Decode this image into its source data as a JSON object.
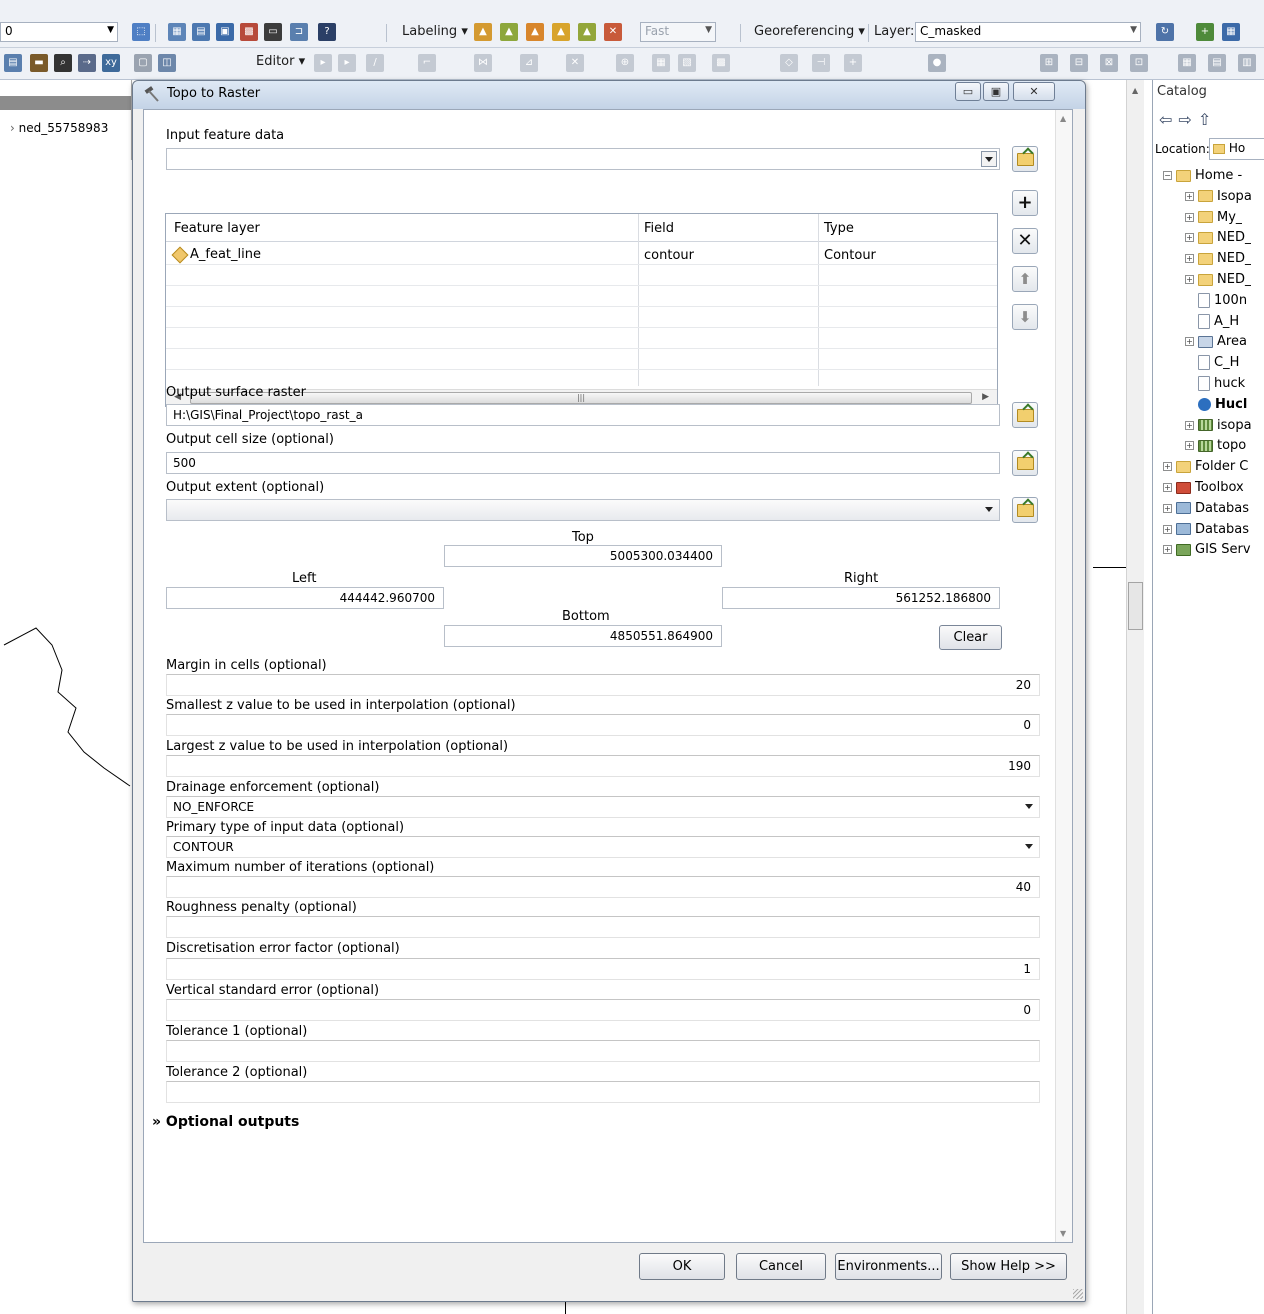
{
  "toolbar": {
    "scale_value": "0",
    "labeling_label": "Labeling",
    "quality_value": "Fast",
    "georeferencing_label": "Georeferencing",
    "layer_label": "Layer:",
    "layer_value": "C_masked",
    "editor_label": "Editor"
  },
  "toc": {
    "layer_name": "ned_55758983"
  },
  "catalog": {
    "title": "Catalog",
    "location_label": "Location:",
    "location_value": "Ho",
    "tree": [
      {
        "label": "Home -",
        "icon": "folder-icon",
        "expand": "minus"
      },
      {
        "label": "Isopa",
        "icon": "folder-icon",
        "expand": "plus"
      },
      {
        "label": "My_",
        "icon": "folder-icon",
        "expand": "plus"
      },
      {
        "label": "NED_",
        "icon": "folder-icon",
        "expand": "plus"
      },
      {
        "label": "NED_",
        "icon": "folder-icon",
        "expand": "plus"
      },
      {
        "label": "NED_",
        "icon": "folder-icon",
        "expand": "plus"
      },
      {
        "label": "100n",
        "icon": "document-icon",
        "expand": ""
      },
      {
        "label": "A_H",
        "icon": "document-icon",
        "expand": ""
      },
      {
        "label": "Area",
        "icon": "feature-class-icon",
        "expand": "plus"
      },
      {
        "label": "C_H",
        "icon": "document-icon",
        "expand": ""
      },
      {
        "label": "huck",
        "icon": "document-icon",
        "expand": ""
      },
      {
        "label": "Hucl",
        "icon": "globe-icon",
        "expand": ""
      },
      {
        "label": "isopa",
        "icon": "raster-icon",
        "expand": "plus"
      },
      {
        "label": "topo",
        "icon": "raster-icon",
        "expand": "plus"
      },
      {
        "label": "Folder C",
        "icon": "folder-connections-icon",
        "expand": "plus"
      },
      {
        "label": "Toolbox",
        "icon": "toolbox-icon",
        "expand": "plus"
      },
      {
        "label": "Databas",
        "icon": "database-icon",
        "expand": "plus"
      },
      {
        "label": "Databas",
        "icon": "database-icon",
        "expand": "plus"
      },
      {
        "label": "GIS Serv",
        "icon": "gis-server-icon",
        "expand": "plus"
      }
    ]
  },
  "dialog": {
    "title": "Topo to Raster",
    "input_feature_label": "Input feature data",
    "input_feature_value": "",
    "table": {
      "columns": [
        "Feature layer",
        "Field",
        "Type"
      ],
      "rows": [
        {
          "layer": "A_feat_line",
          "field": "contour",
          "type": "Contour"
        }
      ]
    },
    "output_raster_label": "Output surface raster",
    "output_raster_value": "H:\\GIS\\Final_Project\\topo_rast_a",
    "cell_size_label": "Output cell size (optional)",
    "cell_size_value": "500",
    "extent_label": "Output extent (optional)",
    "extent_value": "",
    "top_label": "Top",
    "top_value": "5005300.034400",
    "left_label": "Left",
    "left_value": "444442.960700",
    "right_label": "Right",
    "right_value": "561252.186800",
    "bottom_label": "Bottom",
    "bottom_value": "4850551.864900",
    "clear_label": "Clear",
    "margin_label": "Margin in cells (optional)",
    "margin_value": "20",
    "smallest_z_label": "Smallest z value to be used in interpolation (optional)",
    "smallest_z_value": "0",
    "largest_z_label": "Largest z value to be used in interpolation (optional)",
    "largest_z_value": "190",
    "drainage_label": "Drainage enforcement (optional)",
    "drainage_value": "NO_ENFORCE",
    "primary_type_label": "Primary type of input data (optional)",
    "primary_type_value": "CONTOUR",
    "max_iter_label": "Maximum number of iterations (optional)",
    "max_iter_value": "40",
    "roughness_label": "Roughness penalty (optional)",
    "roughness_value": "",
    "discretisation_label": "Discretisation error factor (optional)",
    "discretisation_value": "1",
    "vertical_error_label": "Vertical standard error (optional)",
    "vertical_error_value": "0",
    "tolerance1_label": "Tolerance 1 (optional)",
    "tolerance1_value": "",
    "tolerance2_label": "Tolerance 2 (optional)",
    "tolerance2_value": "",
    "optional_outputs_label": "Optional outputs",
    "buttons": {
      "ok": "OK",
      "cancel": "Cancel",
      "environments": "Environments...",
      "show_help": "Show Help >>"
    }
  }
}
